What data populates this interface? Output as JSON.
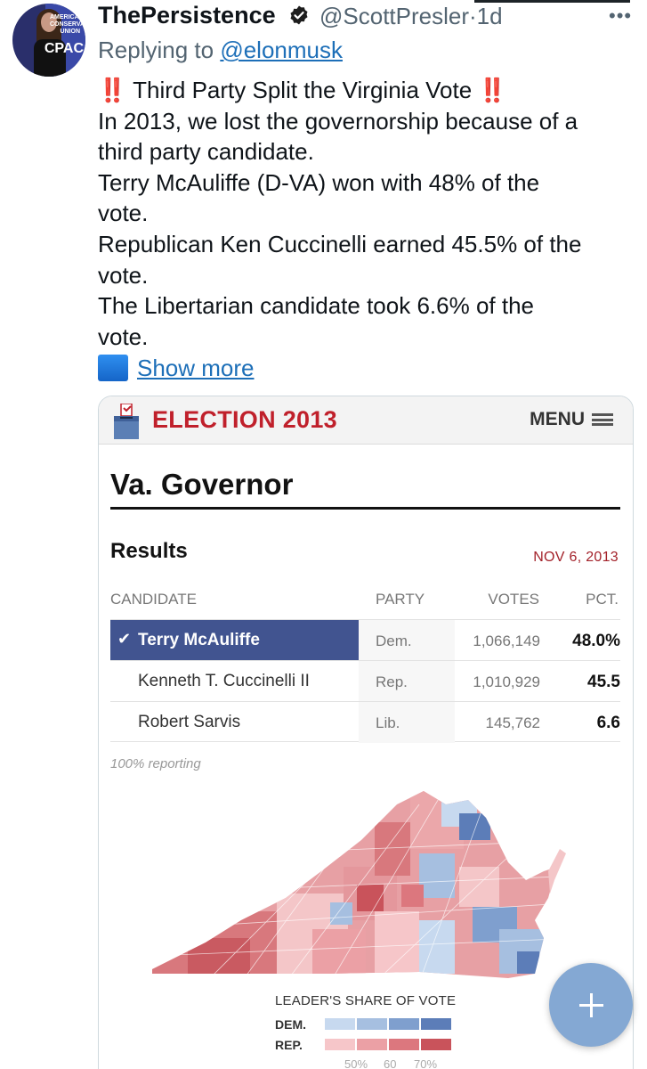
{
  "tweet": {
    "display_name": "ThePersistence",
    "handle": "@ScottPresler",
    "separator": "·",
    "time_ago": "1d",
    "more_label": "•••",
    "replying_prefix": "Replying to",
    "replying_to": "@elonmusk",
    "avatar_text_small": "AMERICAN CONSERVATIVE UNION",
    "avatar_text_large": "CPAC",
    "lines": [
      "‼️ Third Party Split the Virginia Vote ‼️",
      "In 2013, we lost the governorship because of a",
      "third party candidate.",
      "Terry McAuliffe (D-VA) won with 48% of the",
      "vote.",
      "Republican Ken Cuccinelli earned 45.5% of the",
      "vote.",
      "The Libertarian candidate took 6.6% of the",
      "vote."
    ],
    "show_more": "Show more"
  },
  "embedded": {
    "header_title": "ELECTION 2013",
    "menu_label": "MENU",
    "page_title": "Va. Governor",
    "results_label": "Results",
    "date": "NOV 6, 2013",
    "columns": {
      "candidate": "CANDIDATE",
      "party": "PARTY",
      "votes": "VOTES",
      "pct": "PCT."
    },
    "rows": [
      {
        "candidate": "Terry McAuliffe",
        "party": "Dem.",
        "votes": "1,066,149",
        "pct": "48.0%",
        "winner": true
      },
      {
        "candidate": "Kenneth T. Cuccinelli II",
        "party": "Rep.",
        "votes": "1,010,929",
        "pct": "45.5",
        "winner": false
      },
      {
        "candidate": "Robert Sarvis",
        "party": "Lib.",
        "votes": "145,762",
        "pct": "6.6",
        "winner": false
      }
    ],
    "reporting": "100% reporting",
    "legend": {
      "title": "LEADER'S SHARE OF VOTE",
      "dem_label": "DEM.",
      "rep_label": "REP.",
      "dem_colors": [
        "#c7d9ef",
        "#a6bfe0",
        "#7f9fce",
        "#5c7db8"
      ],
      "rep_colors": [
        "#f6c6c9",
        "#eba0a5",
        "#dc777e",
        "#c9535b"
      ],
      "ticks": [
        "50%",
        "60",
        "70%"
      ]
    }
  },
  "colors": {
    "link": "#1d6fb8",
    "election_red": "#c0202b",
    "winner_row": "#415490",
    "fab": "#84a8d3"
  }
}
